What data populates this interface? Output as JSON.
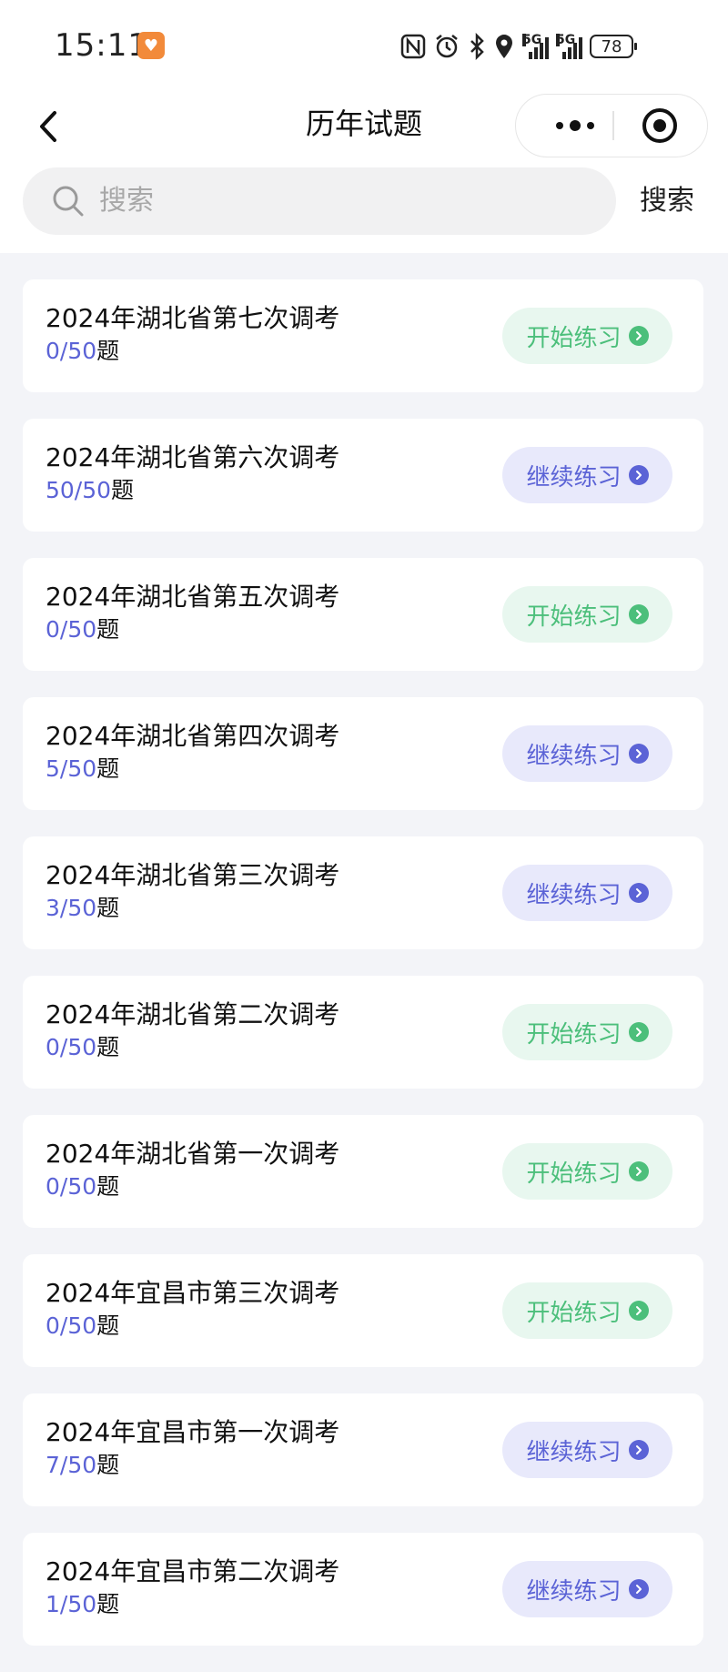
{
  "status_bar": {
    "time": "15:11",
    "battery": "78",
    "network_1": "5G",
    "network_2": "5G",
    "icons": [
      "app-heart-icon",
      "nfc-icon",
      "alarm-icon",
      "bluetooth-icon",
      "location-icon",
      "signal-icon",
      "signal-icon",
      "battery-icon"
    ]
  },
  "nav": {
    "title": "历年试题"
  },
  "search": {
    "placeholder": "搜索",
    "button_label": "搜索"
  },
  "colors": {
    "start_bg": "#e8f7ef",
    "start_fg": "#4cbf7b",
    "continue_bg": "#e8e9fb",
    "continue_fg": "#5b63d6",
    "count_color": "#5b63d6",
    "page_bg": "#f3f4f8"
  },
  "exams": [
    {
      "title": "2024年湖北省第七次调考",
      "done": "0/50",
      "unit": "题",
      "action": "开始练习",
      "state": "start"
    },
    {
      "title": "2024年湖北省第六次调考",
      "done": "50/50",
      "unit": "题",
      "action": "继续练习",
      "state": "continue"
    },
    {
      "title": "2024年湖北省第五次调考",
      "done": "0/50",
      "unit": "题",
      "action": "开始练习",
      "state": "start"
    },
    {
      "title": "2024年湖北省第四次调考",
      "done": "5/50",
      "unit": "题",
      "action": "继续练习",
      "state": "continue"
    },
    {
      "title": "2024年湖北省第三次调考",
      "done": "3/50",
      "unit": "题",
      "action": "继续练习",
      "state": "continue"
    },
    {
      "title": "2024年湖北省第二次调考",
      "done": "0/50",
      "unit": "题",
      "action": "开始练习",
      "state": "start"
    },
    {
      "title": "2024年湖北省第一次调考",
      "done": "0/50",
      "unit": "题",
      "action": "开始练习",
      "state": "start"
    },
    {
      "title": "2024年宜昌市第三次调考",
      "done": "0/50",
      "unit": "题",
      "action": "开始练习",
      "state": "start"
    },
    {
      "title": "2024年宜昌市第一次调考",
      "done": "7/50",
      "unit": "题",
      "action": "继续练习",
      "state": "continue"
    },
    {
      "title": "2024年宜昌市第二次调考",
      "done": "1/50",
      "unit": "题",
      "action": "继续练习",
      "state": "continue"
    }
  ]
}
